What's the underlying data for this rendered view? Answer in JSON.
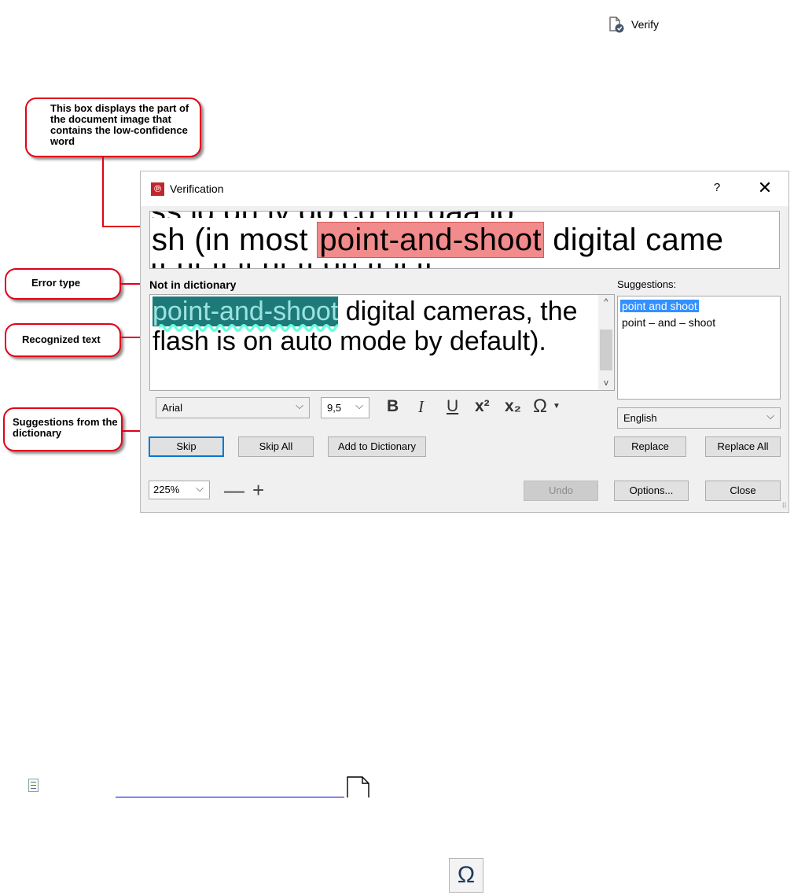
{
  "toolbar": {
    "verify_label": "Verify"
  },
  "callouts": {
    "image_box": "This box displays the part of the document image that contains the low-confidence word",
    "error_type": "Error type",
    "recognized_text": "Recognized text",
    "suggestions": "Suggestions from the dictionary"
  },
  "dialog": {
    "title": "Verification",
    "help": "?",
    "close": "✕",
    "image_text": {
      "before": "sh (in most ",
      "highlight": "point-and-shoot",
      "after": " digital came"
    },
    "error_type": "Not in dictionary",
    "suggestions_label": "Suggestions:",
    "recognized": {
      "word": "point-and-shoot",
      "rest": " digital cameras, the flash is on auto mode by default)."
    },
    "suggestions": [
      "point and shoot",
      "point – and – shoot"
    ],
    "font": "Arial",
    "font_size": "9,5",
    "format_icons": {
      "bold": "B",
      "italic": "I",
      "underline": "U",
      "superscript": "x²",
      "subscript": "x₂",
      "special": "Ω"
    },
    "language": "English",
    "buttons": {
      "skip": "Skip",
      "skip_all": "Skip All",
      "add_dict": "Add to Dictionary",
      "replace": "Replace",
      "replace_all": "Replace All",
      "undo": "Undo",
      "options": "Options...",
      "close": "Close"
    },
    "zoom": "225%"
  },
  "colors": {
    "callout_border": "#e2001a",
    "highlight": "#f28b8b",
    "selection": "#1d7a79",
    "accent": "#0078d7"
  }
}
